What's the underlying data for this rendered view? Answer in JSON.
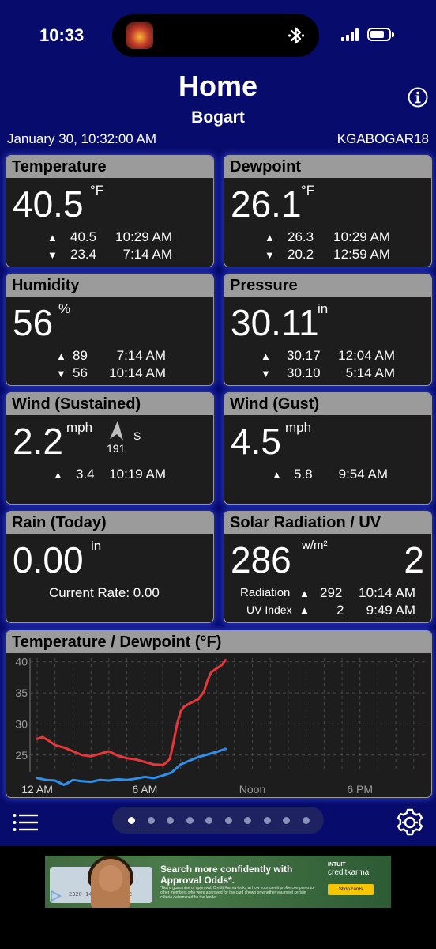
{
  "status_bar": {
    "time": "10:33"
  },
  "header": {
    "title": "Home",
    "subtitle": "Bogart",
    "datetime": "January 30, 10:32:00 AM",
    "station_id": "KGABOGAR18"
  },
  "cards": {
    "temperature": {
      "title": "Temperature",
      "value": "40.5",
      "unit": "°F",
      "high_value": "40.5",
      "high_time": "10:29 AM",
      "low_value": "23.4",
      "low_time": "7:14 AM"
    },
    "dewpoint": {
      "title": "Dewpoint",
      "value": "26.1",
      "unit": "°F",
      "high_value": "26.3",
      "high_time": "10:29 AM",
      "low_value": "20.2",
      "low_time": "12:59 AM"
    },
    "humidity": {
      "title": "Humidity",
      "value": "56",
      "unit": "%",
      "high_value": "89",
      "high_time": "7:14 AM",
      "low_value": "56",
      "low_time": "10:14 AM"
    },
    "pressure": {
      "title": "Pressure",
      "value": "30.11",
      "unit": "in",
      "high_value": "30.17",
      "high_time": "12:04 AM",
      "low_value": "30.10",
      "low_time": "5:14 AM"
    },
    "wind_sustained": {
      "title": "Wind (Sustained)",
      "value": "2.2",
      "unit": "mph",
      "direction_degrees": "191",
      "direction_label": "S",
      "high_value": "3.4",
      "high_time": "10:19 AM"
    },
    "wind_gust": {
      "title": "Wind (Gust)",
      "value": "4.5",
      "unit": "mph",
      "high_value": "5.8",
      "high_time": "9:54 AM"
    },
    "rain": {
      "title": "Rain (Today)",
      "value": "0.00",
      "unit": "in",
      "rate_label": "Current Rate: 0.00"
    },
    "solar": {
      "title": "Solar Radiation / UV",
      "value": "286",
      "unit": "w/m²",
      "uv_value": "2",
      "radiation_label": "Radiation",
      "radiation_high": "292",
      "radiation_time": "10:14 AM",
      "uv_label": "UV Index",
      "uv_high": "2",
      "uv_time": "9:49 AM"
    }
  },
  "chart_data": {
    "type": "line",
    "title": "Temperature / Dewpoint (°F)",
    "xlabel": "",
    "ylabel": "",
    "x_tick_labels": [
      "12 AM",
      "6 AM",
      "Noon",
      "6 PM"
    ],
    "x_ticks": [
      0,
      6,
      12,
      18
    ],
    "xlim": [
      -0.4,
      21.8
    ],
    "y_ticks": [
      25,
      30,
      35,
      40
    ],
    "ylim": [
      22.3,
      40.6
    ],
    "grid": true,
    "series": [
      {
        "color": "#e8373a",
        "x": [
          0,
          0.3,
          0.6,
          1.0,
          1.5,
          2.0,
          2.5,
          3.0,
          3.5,
          4.0,
          4.5,
          5.0,
          5.5,
          6.0,
          6.5,
          7.0,
          7.2,
          7.4,
          7.6,
          7.8,
          8.0,
          8.2,
          8.5,
          9.0,
          9.3,
          9.5,
          9.7,
          10.0,
          10.3,
          10.5
        ],
        "y": [
          27.6,
          27.9,
          27.4,
          26.6,
          26.2,
          25.6,
          25.0,
          24.8,
          25.2,
          25.6,
          24.9,
          24.5,
          24.3,
          23.9,
          23.5,
          23.4,
          23.8,
          24.4,
          27.0,
          30.0,
          32.0,
          32.8,
          33.3,
          34.0,
          35.2,
          37.0,
          38.3,
          38.9,
          39.5,
          40.3
        ]
      },
      {
        "color": "#2f8fea",
        "x": [
          0,
          0.5,
          1.0,
          1.5,
          2.0,
          2.5,
          3.0,
          3.5,
          4.0,
          4.5,
          5.0,
          5.5,
          6.0,
          6.5,
          7.0,
          7.5,
          8.0,
          8.5,
          9.0,
          9.5,
          10.0,
          10.5
        ],
        "y": [
          21.3,
          21.0,
          20.9,
          20.2,
          21.0,
          20.8,
          20.7,
          21.0,
          20.9,
          21.1,
          21.0,
          21.2,
          21.5,
          21.3,
          21.7,
          22.2,
          23.5,
          24.1,
          24.7,
          25.1,
          25.5,
          26.0
        ]
      }
    ]
  },
  "pager": {
    "count": 10,
    "active": 0
  },
  "ad": {
    "headline": "Search more confidently with Approval Odds*.",
    "fine_print": "*Not a guarantee of approval. Credit Karma looks at how your credit profile compares to other members who were approved for the card shown or whether you meet certain criteria determined by the lender.",
    "brand_top": "INTUIT",
    "brand": "creditkarma",
    "cta": "Shop cards",
    "card_number": "2320 1474 4789 5412"
  }
}
